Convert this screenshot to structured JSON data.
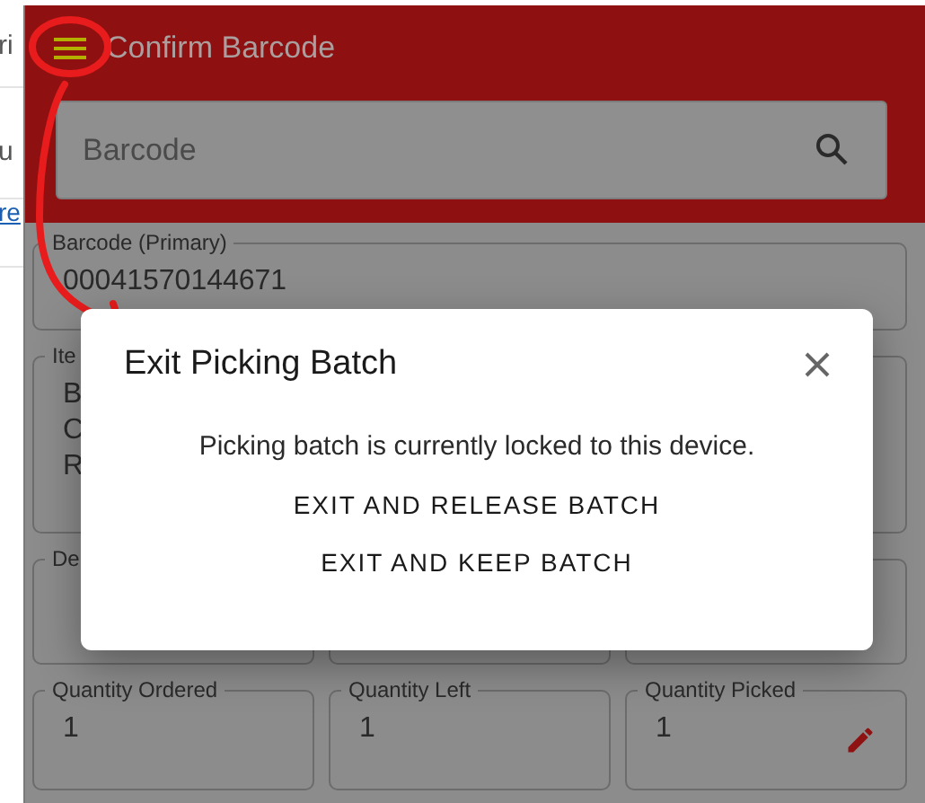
{
  "background_page": {
    "texts": [
      {
        "text": "ri",
        "kind": "text"
      },
      {
        "text": "u",
        "kind": "text"
      },
      {
        "text": "re",
        "kind": "link"
      }
    ]
  },
  "app_bar": {
    "title": "Confirm Barcode"
  },
  "search": {
    "placeholder": "Barcode"
  },
  "field_rows": [
    [
      {
        "label": "Barcode (Primary)",
        "lines": [
          "00041570144671"
        ],
        "editable": false
      }
    ],
    [
      {
        "label": "Ite",
        "lines": [
          "B",
          "C",
          "R"
        ]
      }
    ],
    [
      {
        "label": "De"
      },
      {},
      {}
    ],
    [
      {
        "label": "Quantity Ordered",
        "lines": [
          "1"
        ],
        "editable": false
      },
      {
        "label": "Quantity Left",
        "lines": [
          "1"
        ],
        "editable": false
      },
      {
        "label": "Quantity Picked",
        "lines": [
          "1"
        ],
        "editable": true
      }
    ]
  ],
  "dialog": {
    "title": "Exit Picking Batch",
    "message": "Picking batch is currently locked to this device.",
    "actions": [
      "EXIT AND RELEASE BATCH",
      "EXIT AND KEEP BATCH"
    ]
  }
}
